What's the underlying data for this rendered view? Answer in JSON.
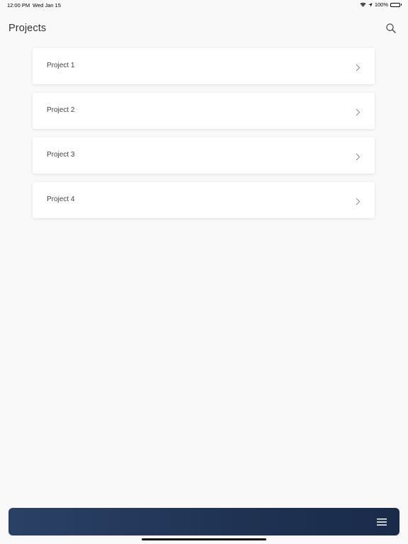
{
  "status_bar": {
    "time": "12:00 PM",
    "date": "Wed Jan 15",
    "battery": "100%",
    "icons": [
      "wifi-icon",
      "location-arrow-icon",
      "battery-icon"
    ]
  },
  "header": {
    "title": "Projects",
    "search_icon": "search-icon"
  },
  "projects": [
    {
      "label": "Project 1"
    },
    {
      "label": "Project 2"
    },
    {
      "label": "Project 3"
    },
    {
      "label": "Project 4"
    }
  ],
  "bottom_bar": {
    "menu_icon": "hamburger-menu-icon"
  },
  "colors": {
    "background": "#f9f9f9",
    "card": "#ffffff",
    "bottom_bar_start": "#2a4166",
    "bottom_bar_end": "#1a2b4a",
    "text": "#333333"
  }
}
